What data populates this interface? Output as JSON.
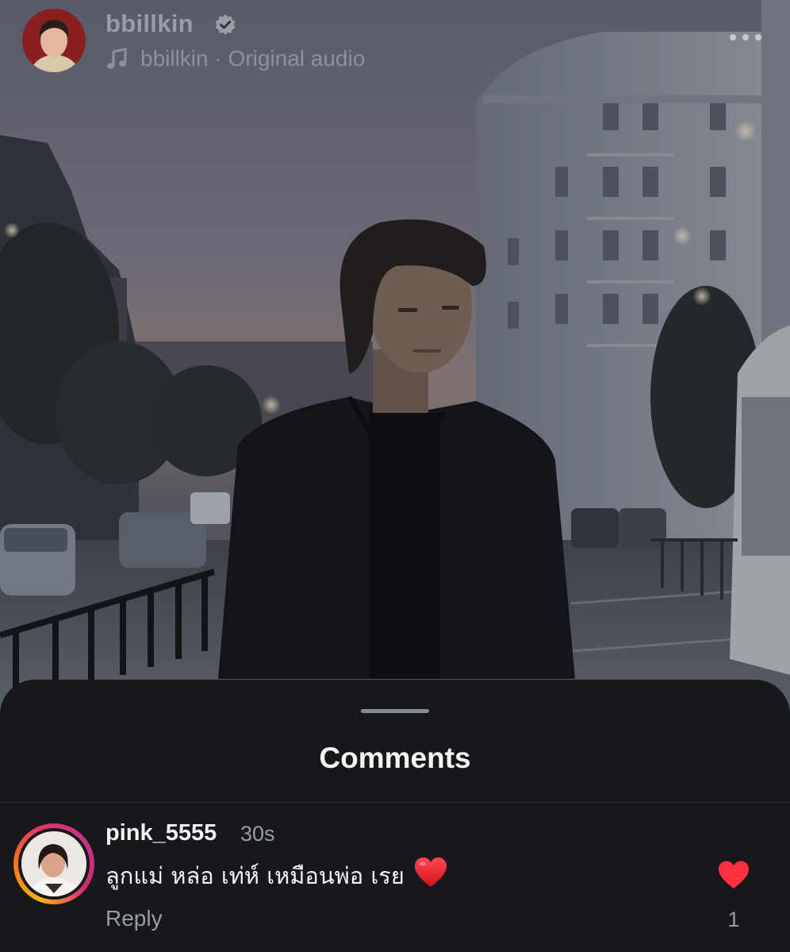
{
  "reel": {
    "author": "bbillkin",
    "verified": true,
    "audio_author": "bbillkin",
    "audio_separator": "·",
    "audio_title": "Original audio",
    "icons": {
      "verified": "verified-badge-icon",
      "audio": "music-note-icon",
      "more": "more-options-icon"
    }
  },
  "comments_sheet": {
    "title": "Comments",
    "comments": [
      {
        "username": "pink_5555",
        "time": "30s",
        "text": "ลูกแม่ หล่อ เท่ห์ เหมือนพ่อ เรย",
        "emoji": "red-heart-emoji",
        "reply_label": "Reply",
        "like_count": "1",
        "liked": true,
        "has_story_ring": true
      }
    ]
  },
  "colors": {
    "sheet_background": "#16181b",
    "like_red": "#ff3040",
    "secondary_text": "#9a9ca3",
    "primary_text": "#f2f2f2"
  }
}
